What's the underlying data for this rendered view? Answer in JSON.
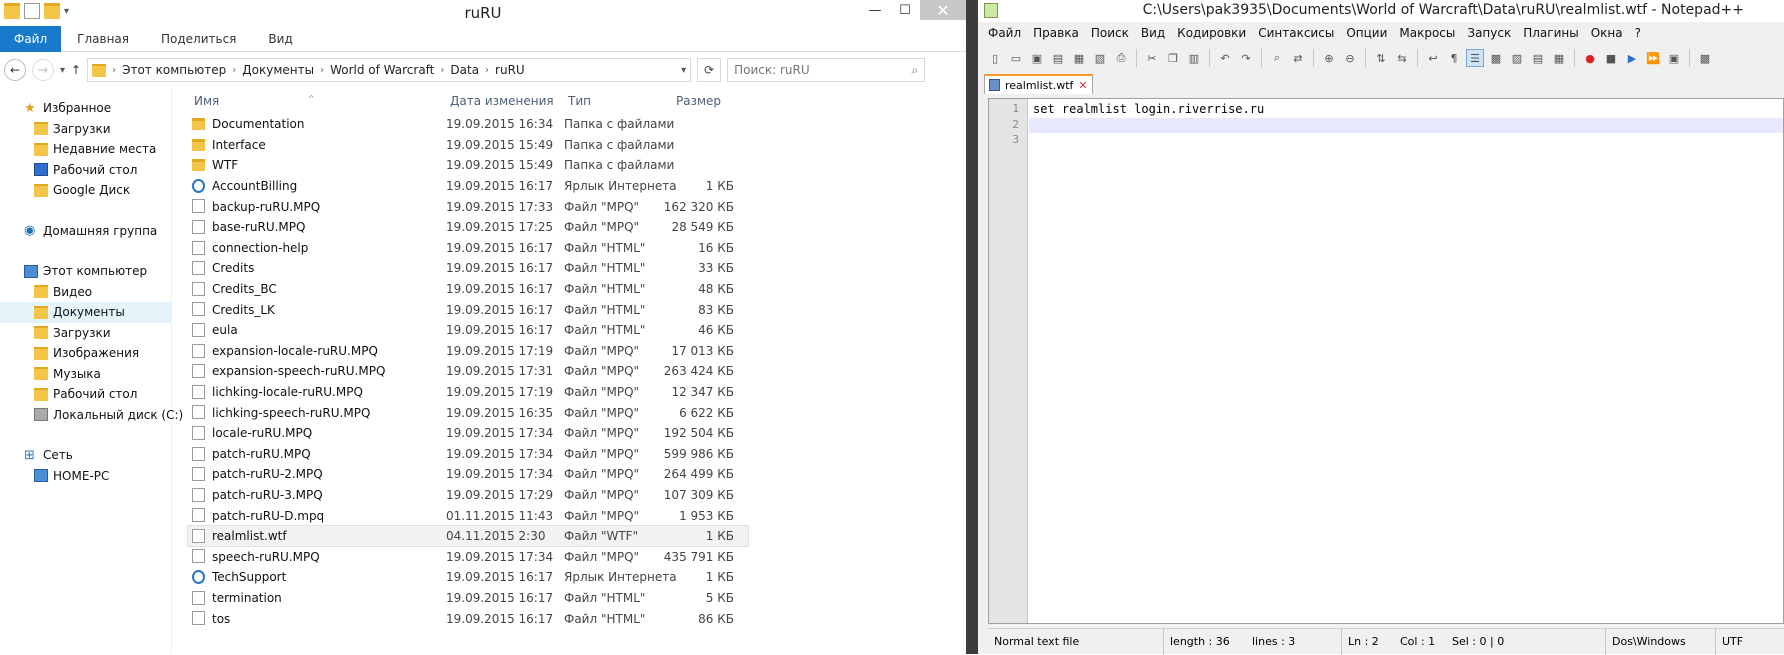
{
  "explorer": {
    "title": "ruRU",
    "ribbon_tabs": {
      "file": "Файл",
      "home": "Главная",
      "share": "Поделиться",
      "view": "Вид"
    },
    "breadcrumb": [
      "Этот компьютер",
      "Документы",
      "World of Warcraft",
      "Data",
      "ruRU"
    ],
    "search_placeholder": "Поиск: ruRU",
    "nav": {
      "favorites": "Избранное",
      "fav_items": [
        "Загрузки",
        "Недавние места",
        "Рабочий стол",
        "Google Диск"
      ],
      "homegroup": "Домашняя группа",
      "this_pc": "Этот компьютер",
      "pc_items": [
        "Видео",
        "Документы",
        "Загрузки",
        "Изображения",
        "Музыка",
        "Рабочий стол",
        "Локальный диск (C:)"
      ],
      "network": "Сеть",
      "net_items": [
        "HOME-PC"
      ]
    },
    "columns": {
      "name": "Имя",
      "date": "Дата изменения",
      "type": "Тип",
      "size": "Размер"
    },
    "files": [
      {
        "name": "Documentation",
        "date": "19.09.2015 16:34",
        "type": "Папка с файлами",
        "size": "",
        "icon": "folder"
      },
      {
        "name": "Interface",
        "date": "19.09.2015 15:49",
        "type": "Папка с файлами",
        "size": "",
        "icon": "folder"
      },
      {
        "name": "WTF",
        "date": "19.09.2015 15:49",
        "type": "Папка с файлами",
        "size": "",
        "icon": "folder"
      },
      {
        "name": "AccountBilling",
        "date": "19.09.2015 16:17",
        "type": "Ярлык Интернета",
        "size": "1 КБ",
        "icon": "web"
      },
      {
        "name": "backup-ruRU.MPQ",
        "date": "19.09.2015 17:33",
        "type": "Файл \"MPQ\"",
        "size": "162 320 КБ",
        "icon": "doc"
      },
      {
        "name": "base-ruRU.MPQ",
        "date": "19.09.2015 17:25",
        "type": "Файл \"MPQ\"",
        "size": "28 549 КБ",
        "icon": "doc"
      },
      {
        "name": "connection-help",
        "date": "19.09.2015 16:17",
        "type": "Файл \"HTML\"",
        "size": "16 КБ",
        "icon": "doc"
      },
      {
        "name": "Credits",
        "date": "19.09.2015 16:17",
        "type": "Файл \"HTML\"",
        "size": "33 КБ",
        "icon": "doc"
      },
      {
        "name": "Credits_BC",
        "date": "19.09.2015 16:17",
        "type": "Файл \"HTML\"",
        "size": "48 КБ",
        "icon": "doc"
      },
      {
        "name": "Credits_LK",
        "date": "19.09.2015 16:17",
        "type": "Файл \"HTML\"",
        "size": "83 КБ",
        "icon": "doc"
      },
      {
        "name": "eula",
        "date": "19.09.2015 16:17",
        "type": "Файл \"HTML\"",
        "size": "46 КБ",
        "icon": "doc"
      },
      {
        "name": "expansion-locale-ruRU.MPQ",
        "date": "19.09.2015 17:19",
        "type": "Файл \"MPQ\"",
        "size": "17 013 КБ",
        "icon": "doc"
      },
      {
        "name": "expansion-speech-ruRU.MPQ",
        "date": "19.09.2015 17:31",
        "type": "Файл \"MPQ\"",
        "size": "263 424 КБ",
        "icon": "doc"
      },
      {
        "name": "lichking-locale-ruRU.MPQ",
        "date": "19.09.2015 17:19",
        "type": "Файл \"MPQ\"",
        "size": "12 347 КБ",
        "icon": "doc"
      },
      {
        "name": "lichking-speech-ruRU.MPQ",
        "date": "19.09.2015 16:35",
        "type": "Файл \"MPQ\"",
        "size": "6 622 КБ",
        "icon": "doc"
      },
      {
        "name": "locale-ruRU.MPQ",
        "date": "19.09.2015 17:34",
        "type": "Файл \"MPQ\"",
        "size": "192 504 КБ",
        "icon": "doc"
      },
      {
        "name": "patch-ruRU.MPQ",
        "date": "19.09.2015 17:34",
        "type": "Файл \"MPQ\"",
        "size": "599 986 КБ",
        "icon": "doc"
      },
      {
        "name": "patch-ruRU-2.MPQ",
        "date": "19.09.2015 17:34",
        "type": "Файл \"MPQ\"",
        "size": "264 499 КБ",
        "icon": "doc"
      },
      {
        "name": "patch-ruRU-3.MPQ",
        "date": "19.09.2015 17:29",
        "type": "Файл \"MPQ\"",
        "size": "107 309 КБ",
        "icon": "doc"
      },
      {
        "name": "patch-ruRU-D.mpq",
        "date": "01.11.2015 11:43",
        "type": "Файл \"MPQ\"",
        "size": "1 953 КБ",
        "icon": "doc"
      },
      {
        "name": "realmlist.wtf",
        "date": "04.11.2015 2:30",
        "type": "Файл \"WTF\"",
        "size": "1 КБ",
        "icon": "doc",
        "selected": true
      },
      {
        "name": "speech-ruRU.MPQ",
        "date": "19.09.2015 17:34",
        "type": "Файл \"MPQ\"",
        "size": "435 791 КБ",
        "icon": "doc"
      },
      {
        "name": "TechSupport",
        "date": "19.09.2015 16:17",
        "type": "Ярлык Интернета",
        "size": "1 КБ",
        "icon": "web"
      },
      {
        "name": "termination",
        "date": "19.09.2015 16:17",
        "type": "Файл \"HTML\"",
        "size": "5 КБ",
        "icon": "doc"
      },
      {
        "name": "tos",
        "date": "19.09.2015 16:17",
        "type": "Файл \"HTML\"",
        "size": "86 КБ",
        "icon": "doc"
      }
    ]
  },
  "notepad": {
    "title": "C:\\Users\\pak3935\\Documents\\World of Warcraft\\Data\\ruRU\\realmlist.wtf - Notepad++",
    "menu": [
      "Файл",
      "Правка",
      "Поиск",
      "Вид",
      "Кодировки",
      "Синтаксисы",
      "Опции",
      "Макросы",
      "Запуск",
      "Плагины",
      "Окна",
      "?"
    ],
    "tab": "realmlist.wtf",
    "lines": [
      "set realmlist login.riverrise.ru",
      "",
      ""
    ],
    "line_numbers": [
      "1",
      "2",
      "3"
    ],
    "status": {
      "type": "Normal text file",
      "length": "length : 36",
      "lines": "lines : 3",
      "ln": "Ln : 2",
      "col": "Col : 1",
      "sel": "Sel : 0 | 0",
      "eol": "Dos\\Windows",
      "enc": "UTF"
    }
  }
}
